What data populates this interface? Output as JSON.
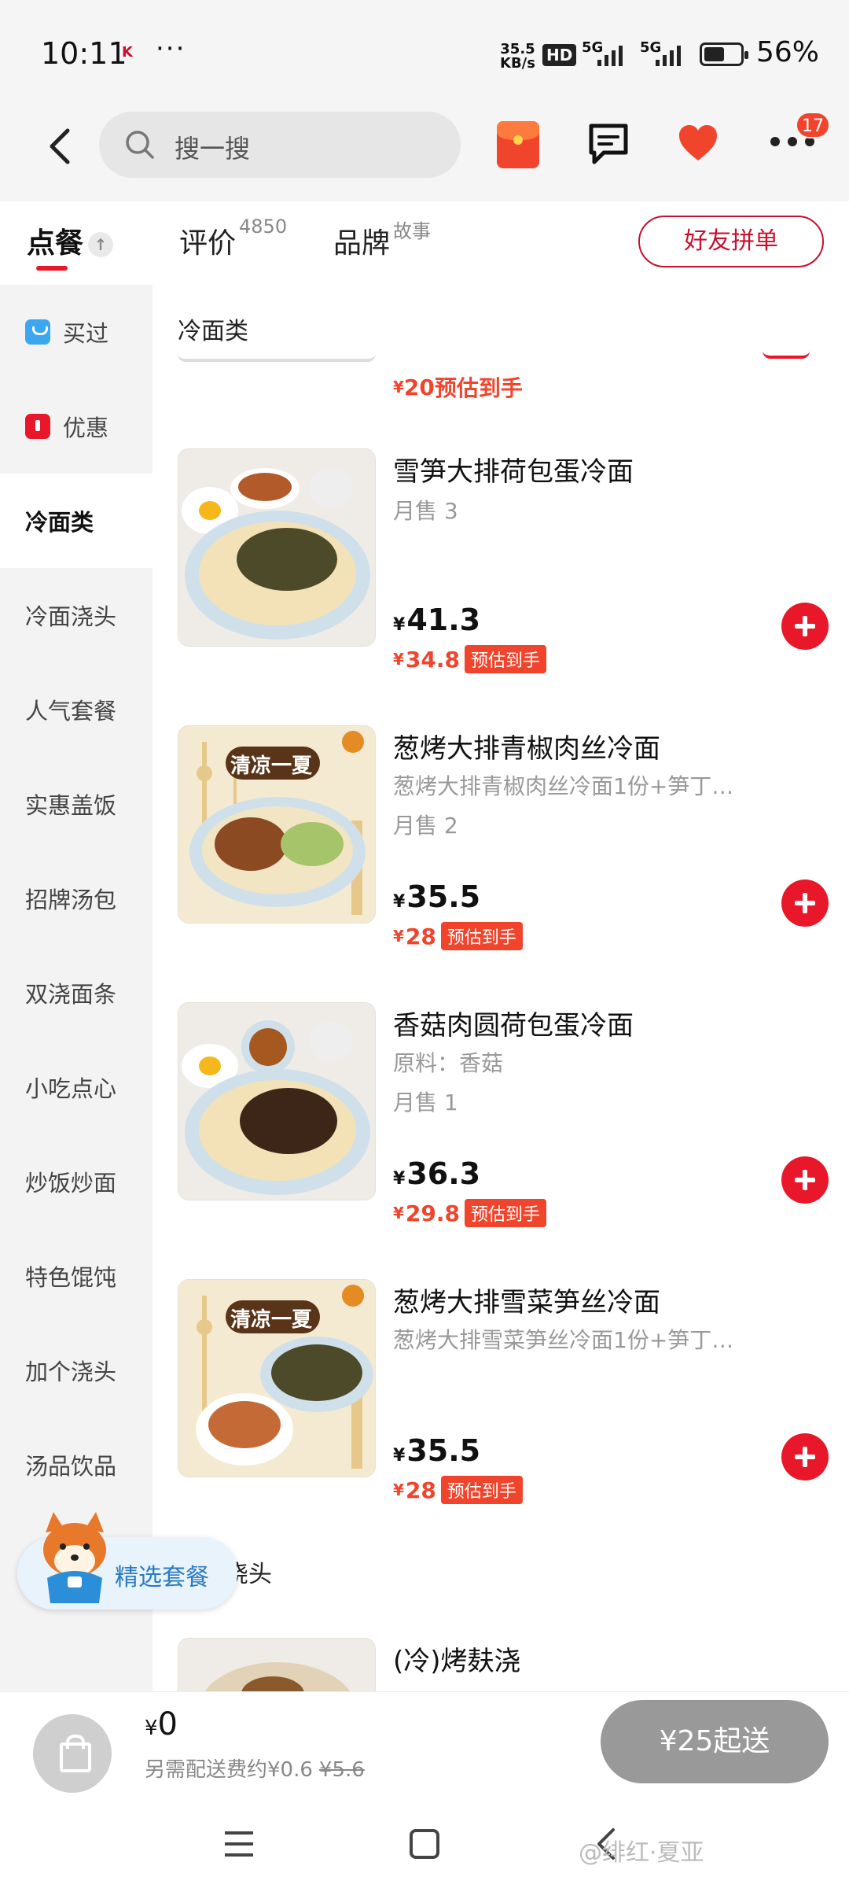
{
  "status_bar": {
    "time": "10:11",
    "more": "···",
    "net_speed_value": "35.5",
    "net_speed_unit": "KB/s",
    "hd": "HD",
    "sim1": "5G",
    "sim2": "5G",
    "battery_pct_text": "56%",
    "battery_level": 0.56
  },
  "nav": {
    "search_placeholder": "搜一搜",
    "badge_count": "17"
  },
  "tabs": {
    "order": "点餐",
    "reviews": "评价",
    "reviews_count": "4850",
    "brand": "品牌",
    "brand_sup": "故事",
    "group_order": "好友拼单"
  },
  "sidebar": {
    "items": [
      {
        "label": "买过"
      },
      {
        "label": "优惠"
      },
      {
        "label": "冷面类"
      },
      {
        "label": "冷面浇头"
      },
      {
        "label": "人气套餐"
      },
      {
        "label": "实惠盖饭"
      },
      {
        "label": "招牌汤包"
      },
      {
        "label": "双浇面条"
      },
      {
        "label": "小吃点心"
      },
      {
        "label": "炒饭炒面"
      },
      {
        "label": "特色馄饨"
      },
      {
        "label": "加个浇头"
      },
      {
        "label": "汤品饮品"
      }
    ]
  },
  "content": {
    "section_title": "冷面类",
    "partial_top_price": "20",
    "est_tag": "预估到手",
    "yen": "¥",
    "items": [
      {
        "name": "雪笋大排荷包蛋冷面",
        "desc": "",
        "sales": "月售 3",
        "price": "41.3",
        "est": "34.8"
      },
      {
        "name": "葱烤大排青椒肉丝冷面",
        "desc": "葱烤大排青椒肉丝冷面1份+笋丁…",
        "sales": "月售 2",
        "price": "35.5",
        "est": "28"
      },
      {
        "name": "香菇肉圆荷包蛋冷面",
        "desc": "原料：香菇",
        "sales": "月售 1",
        "price": "36.3",
        "est": "29.8"
      },
      {
        "name": "葱烤大排雪菜笋丝冷面",
        "desc": "葱烤大排雪菜笋丝冷面1份+笋丁…",
        "sales": "",
        "price": "35.5",
        "est": "28"
      }
    ],
    "next_section_title": "冷面浇头",
    "next_item_name": "(冷)烤麸浇",
    "thumb_caption": "清凉一夏"
  },
  "bubble": {
    "label": "精选套餐"
  },
  "cart": {
    "total": "0",
    "fee_text": "另需配送费约¥0.6",
    "fee_original": "¥5.6",
    "checkout": "¥25起送"
  },
  "watermark": "@绯红·夏亚",
  "colors": {
    "brand_red": "#e8182a",
    "price_orange": "#f0452c",
    "sidebar_bg": "#f3f3f3"
  }
}
